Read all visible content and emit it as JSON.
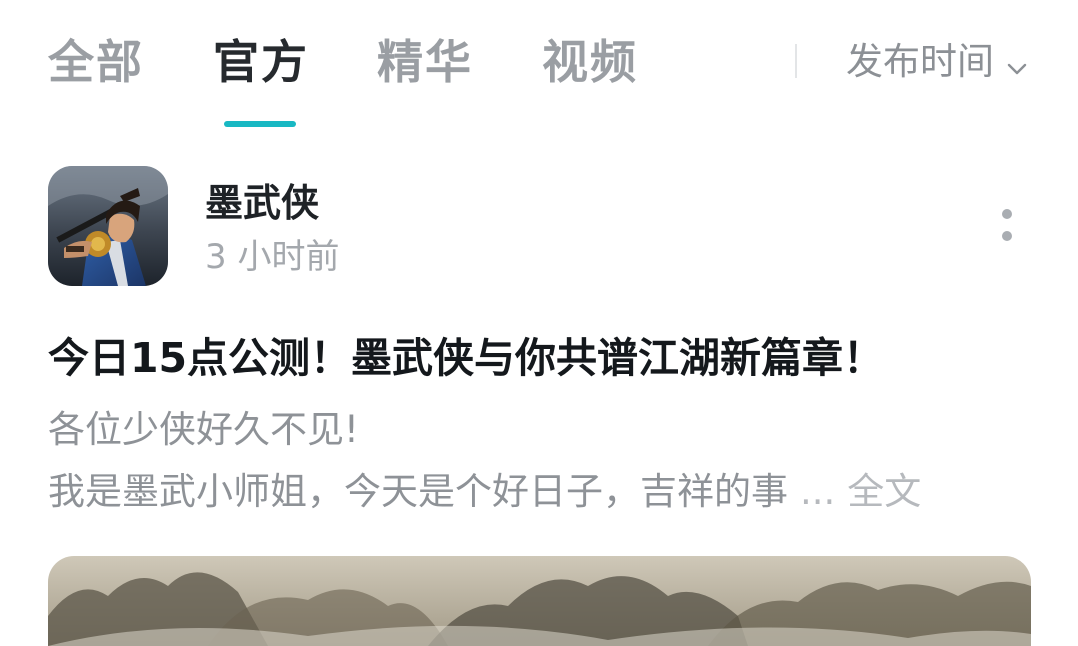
{
  "tabs": [
    {
      "label": "全部",
      "active": false
    },
    {
      "label": "官方",
      "active": true
    },
    {
      "label": "精华",
      "active": false
    },
    {
      "label": "视频",
      "active": false
    }
  ],
  "sort": {
    "label": "发布时间",
    "icon": "chevron-down-icon"
  },
  "colors": {
    "accent": "#18b8c3",
    "active_tab": "#262a2e",
    "inactive_tab": "#9a9ea3"
  },
  "post": {
    "author": "墨武侠",
    "time": "3 小时前",
    "more_icon": "more-vertical-icon",
    "title": "今日15点公测！墨武侠与你共谱江湖新篇章！",
    "excerpt": [
      "各位少侠好久不见!",
      "我是墨武小师姐，今天是个好日子，吉祥的事"
    ],
    "ellipsis": "...",
    "full_text_label": "全文"
  }
}
